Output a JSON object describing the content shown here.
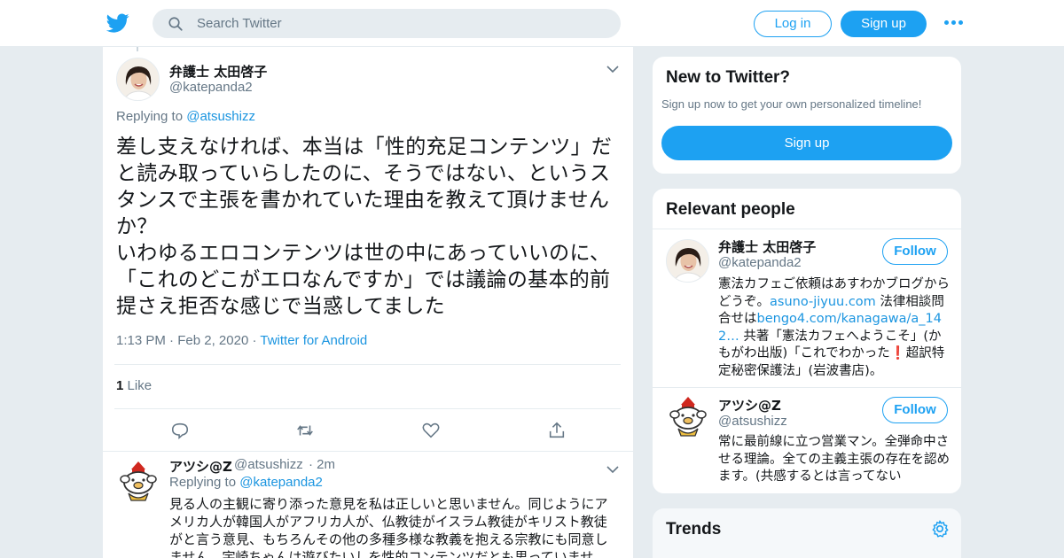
{
  "header": {
    "search_placeholder": "Search Twitter",
    "login_label": "Log in",
    "signup_label": "Sign up",
    "icons": [
      "twitter-bird-icon",
      "search-icon",
      "more-dots-icon"
    ]
  },
  "main_tweet": {
    "author_name": "弁護士 太田啓子",
    "author_handle": "@katepanda2",
    "replying_prefix": "Replying to",
    "replying_to": "@atsushizz",
    "text": "差し支えなければ、本当は「性的充足コンテンツ」だと読み取っていらしたのに、そうではない、というスタンスで主張を書かれていた理由を教えて頂けませんか？\nいわゆるエロコンテンツは世の中にあっていいのに、「これのどこがエロなんですか」では議論の基本的前提さえ拒否な感じで当惑してました",
    "time": "1:13 PM",
    "date": "Feb 2, 2020",
    "source": "Twitter for Android",
    "like_count": "1",
    "like_label": "Like",
    "actions": [
      "reply-icon",
      "retweet-icon",
      "like-icon",
      "share-icon"
    ]
  },
  "reply_tweet": {
    "author_name": "アツシ@Z",
    "author_handle": "@atsushizz",
    "time_ago": "2m",
    "replying_prefix": "Replying to",
    "replying_to": "@katepanda2",
    "text": "見る人の主観に寄り添った意見を私は正しいと思いません。同じようにアメリカ人が韓国人がアフリカ人が、仏教徒がイスラム教徒がキリスト教徒がと言う意見、もちろんその他の多種多様な教義を抱える宗教にも同意しません。宇崎ちゃんは遊びたいしを性的コンテンツだとも思っていませ"
  },
  "sidebar": {
    "new_to_twitter": {
      "title": "New to Twitter?",
      "subtitle": "Sign up now to get your own personalized timeline!",
      "button": "Sign up"
    },
    "relevant_people": {
      "title": "Relevant people",
      "follow_label": "Follow",
      "people": [
        {
          "name": "弁護士 太田啓子",
          "handle": "@katepanda2",
          "bio_a": "憲法カフェご依頼はあすわかブログからどうぞ。",
          "bio_link1": "asuno-jiyuu.com",
          "bio_b": " 法律相談問合せは",
          "bio_link2": "bengo4.com/kanagawa/a_142…",
          "bio_c": " 共著「憲法カフェへようこそ」(かもがわ出版)「これでわかった",
          "bio_emoji": "❗",
          "bio_d": "超訳特定秘密保護法」(岩波書店)。"
        },
        {
          "name": "アツシ@Z",
          "handle": "@atsushizz",
          "bio": "常に最前線に立つ営業マン。全弾命中させる理論。全ての主義主張の存在を認めます。(共感するとは言ってない"
        }
      ]
    },
    "trends": {
      "title": "Trends",
      "icon": "settings-gear-icon"
    }
  }
}
